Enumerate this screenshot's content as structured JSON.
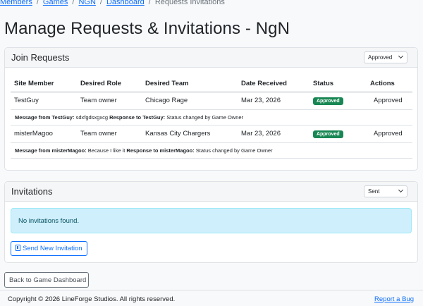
{
  "breadcrumb": {
    "items": [
      "Members",
      "Games",
      "NGN",
      "Dashboard"
    ],
    "current": "Requests Invitations"
  },
  "page_title": "Manage Requests & Invitations - NgN",
  "join_requests": {
    "title": "Join Requests",
    "filter_value": "Approved",
    "columns": [
      "Site Member",
      "Desired Role",
      "Desired Team",
      "Date Received",
      "Status",
      "Actions"
    ],
    "rows": [
      {
        "member": "TestGuy",
        "role": "Team owner",
        "team": "Chicago Rage",
        "date": "Mar 23, 2026",
        "status": "Approved",
        "action": "Approved",
        "message_label": "Message from TestGuy:",
        "message": "sdxfgdsxgxcg",
        "response_label": "Response to TestGuy:",
        "response": "Status changed by Game Owner"
      },
      {
        "member": "misterMagoo",
        "role": "Team owner",
        "team": "Kansas City Chargers",
        "date": "Mar 23, 2026",
        "status": "Approved",
        "action": "Approved",
        "message_label": "Message from misterMagoo:",
        "message": "Because I like it",
        "response_label": "Response to misterMagoo:",
        "response": "Status changed by Game Owner"
      }
    ]
  },
  "invitations": {
    "title": "Invitations",
    "filter_value": "Sent",
    "empty_text": "No invitations found.",
    "send_button": "Send New Invitation"
  },
  "back_button": "Back to Game Dashboard",
  "footer": {
    "copyright": "Copyright © 2026 LineForge Studios. All rights reserved.",
    "report_link": "Report a Bug"
  },
  "colors": {
    "primary": "#0d6efd",
    "success": "#198754",
    "info_bg": "#cfeffc"
  }
}
